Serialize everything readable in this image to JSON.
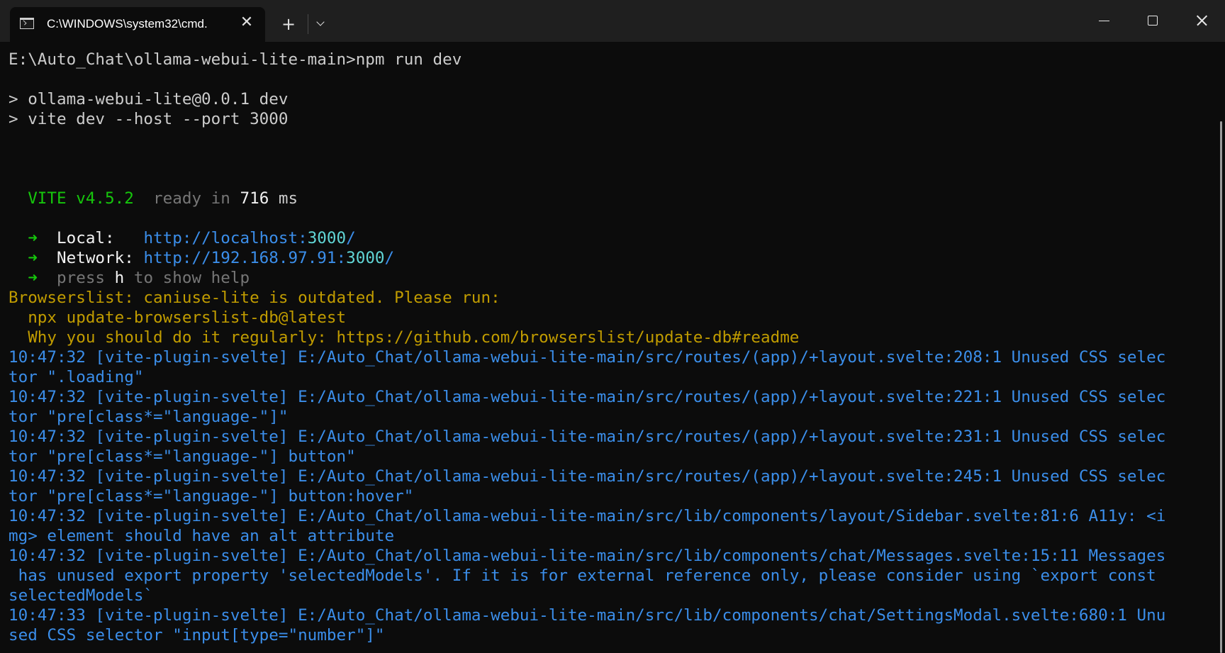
{
  "tab": {
    "title": "C:\\WINDOWS\\system32\\cmd.",
    "close_label": "✕",
    "icon": "terminal-icon"
  },
  "toolbar": {
    "new_tab_label": "+",
    "dropdown_icon": "chevron-down-icon"
  },
  "window_controls": {
    "minimize_icon": "minimize-icon",
    "maximize_icon": "maximize-icon",
    "close_icon": "close-icon"
  },
  "colors": {
    "default": "#cccccc",
    "bright": "#f2f2f2",
    "green": "#16c60c",
    "dim": "#767676",
    "yellow": "#c19c00",
    "blue": "#3b8eea",
    "cyan": "#61d6d6"
  },
  "terminal": {
    "lines": [
      [
        {
          "text": "E:\\Auto_Chat\\ollama-webui-lite-main>npm run dev",
          "color": "default"
        }
      ],
      [],
      [
        {
          "text": "> ollama-webui-lite@0.0.1 dev",
          "color": "default"
        }
      ],
      [
        {
          "text": "> vite dev --host --port 3000",
          "color": "default"
        }
      ],
      [],
      [],
      [],
      [
        {
          "text": "  VITE v4.5.2",
          "color": "green"
        },
        {
          "text": "  ready in ",
          "color": "dim"
        },
        {
          "text": "716",
          "color": "bright"
        },
        {
          "text": " ms",
          "color": "default"
        }
      ],
      [],
      [
        {
          "text": "  ➜",
          "color": "green"
        },
        {
          "text": "  Local:   ",
          "color": "bright"
        },
        {
          "text": "http://localhost:",
          "color": "blue"
        },
        {
          "text": "3000",
          "color": "cyan"
        },
        {
          "text": "/",
          "color": "blue"
        }
      ],
      [
        {
          "text": "  ➜",
          "color": "green"
        },
        {
          "text": "  Network: ",
          "color": "bright"
        },
        {
          "text": "http://192.168.97.91:",
          "color": "blue"
        },
        {
          "text": "3000",
          "color": "cyan"
        },
        {
          "text": "/",
          "color": "blue"
        }
      ],
      [
        {
          "text": "  ➜",
          "color": "green"
        },
        {
          "text": "  press ",
          "color": "dim"
        },
        {
          "text": "h",
          "color": "bright"
        },
        {
          "text": " to show help",
          "color": "dim"
        }
      ],
      [
        {
          "text": "Browserslist: caniuse-lite is outdated. Please run:",
          "color": "yellow"
        }
      ],
      [
        {
          "text": "  npx update-browserslist-db@latest",
          "color": "yellow"
        }
      ],
      [
        {
          "text": "  Why you should do it regularly: https://github.com/browserslist/update-db#readme",
          "color": "yellow"
        }
      ],
      [
        {
          "text": "10:47:32 [vite-plugin-svelte] E:/Auto_Chat/ollama-webui-lite-main/src/routes/(app)/+layout.svelte:208:1 Unused CSS selec",
          "color": "blue"
        }
      ],
      [
        {
          "text": "tor \".loading\"",
          "color": "blue"
        }
      ],
      [
        {
          "text": "10:47:32 [vite-plugin-svelte] E:/Auto_Chat/ollama-webui-lite-main/src/routes/(app)/+layout.svelte:221:1 Unused CSS selec",
          "color": "blue"
        }
      ],
      [
        {
          "text": "tor \"pre[class*=\"language-\"]\"",
          "color": "blue"
        }
      ],
      [
        {
          "text": "10:47:32 [vite-plugin-svelte] E:/Auto_Chat/ollama-webui-lite-main/src/routes/(app)/+layout.svelte:231:1 Unused CSS selec",
          "color": "blue"
        }
      ],
      [
        {
          "text": "tor \"pre[class*=\"language-\"] button\"",
          "color": "blue"
        }
      ],
      [
        {
          "text": "10:47:32 [vite-plugin-svelte] E:/Auto_Chat/ollama-webui-lite-main/src/routes/(app)/+layout.svelte:245:1 Unused CSS selec",
          "color": "blue"
        }
      ],
      [
        {
          "text": "tor \"pre[class*=\"language-\"] button:hover\"",
          "color": "blue"
        }
      ],
      [
        {
          "text": "10:47:32 [vite-plugin-svelte] E:/Auto_Chat/ollama-webui-lite-main/src/lib/components/layout/Sidebar.svelte:81:6 A11y: <i",
          "color": "blue"
        }
      ],
      [
        {
          "text": "mg> element should have an alt attribute",
          "color": "blue"
        }
      ],
      [
        {
          "text": "10:47:32 [vite-plugin-svelte] E:/Auto_Chat/ollama-webui-lite-main/src/lib/components/chat/Messages.svelte:15:11 Messages",
          "color": "blue"
        }
      ],
      [
        {
          "text": " has unused export property 'selectedModels'. If it is for external reference only, please consider using `export const ",
          "color": "blue"
        }
      ],
      [
        {
          "text": "selectedModels`",
          "color": "blue"
        }
      ],
      [
        {
          "text": "10:47:33 [vite-plugin-svelte] E:/Auto_Chat/ollama-webui-lite-main/src/lib/components/chat/SettingsModal.svelte:680:1 Unu",
          "color": "blue"
        }
      ],
      [
        {
          "text": "sed CSS selector \"input[type=\"number\"]\"",
          "color": "blue"
        }
      ]
    ]
  }
}
